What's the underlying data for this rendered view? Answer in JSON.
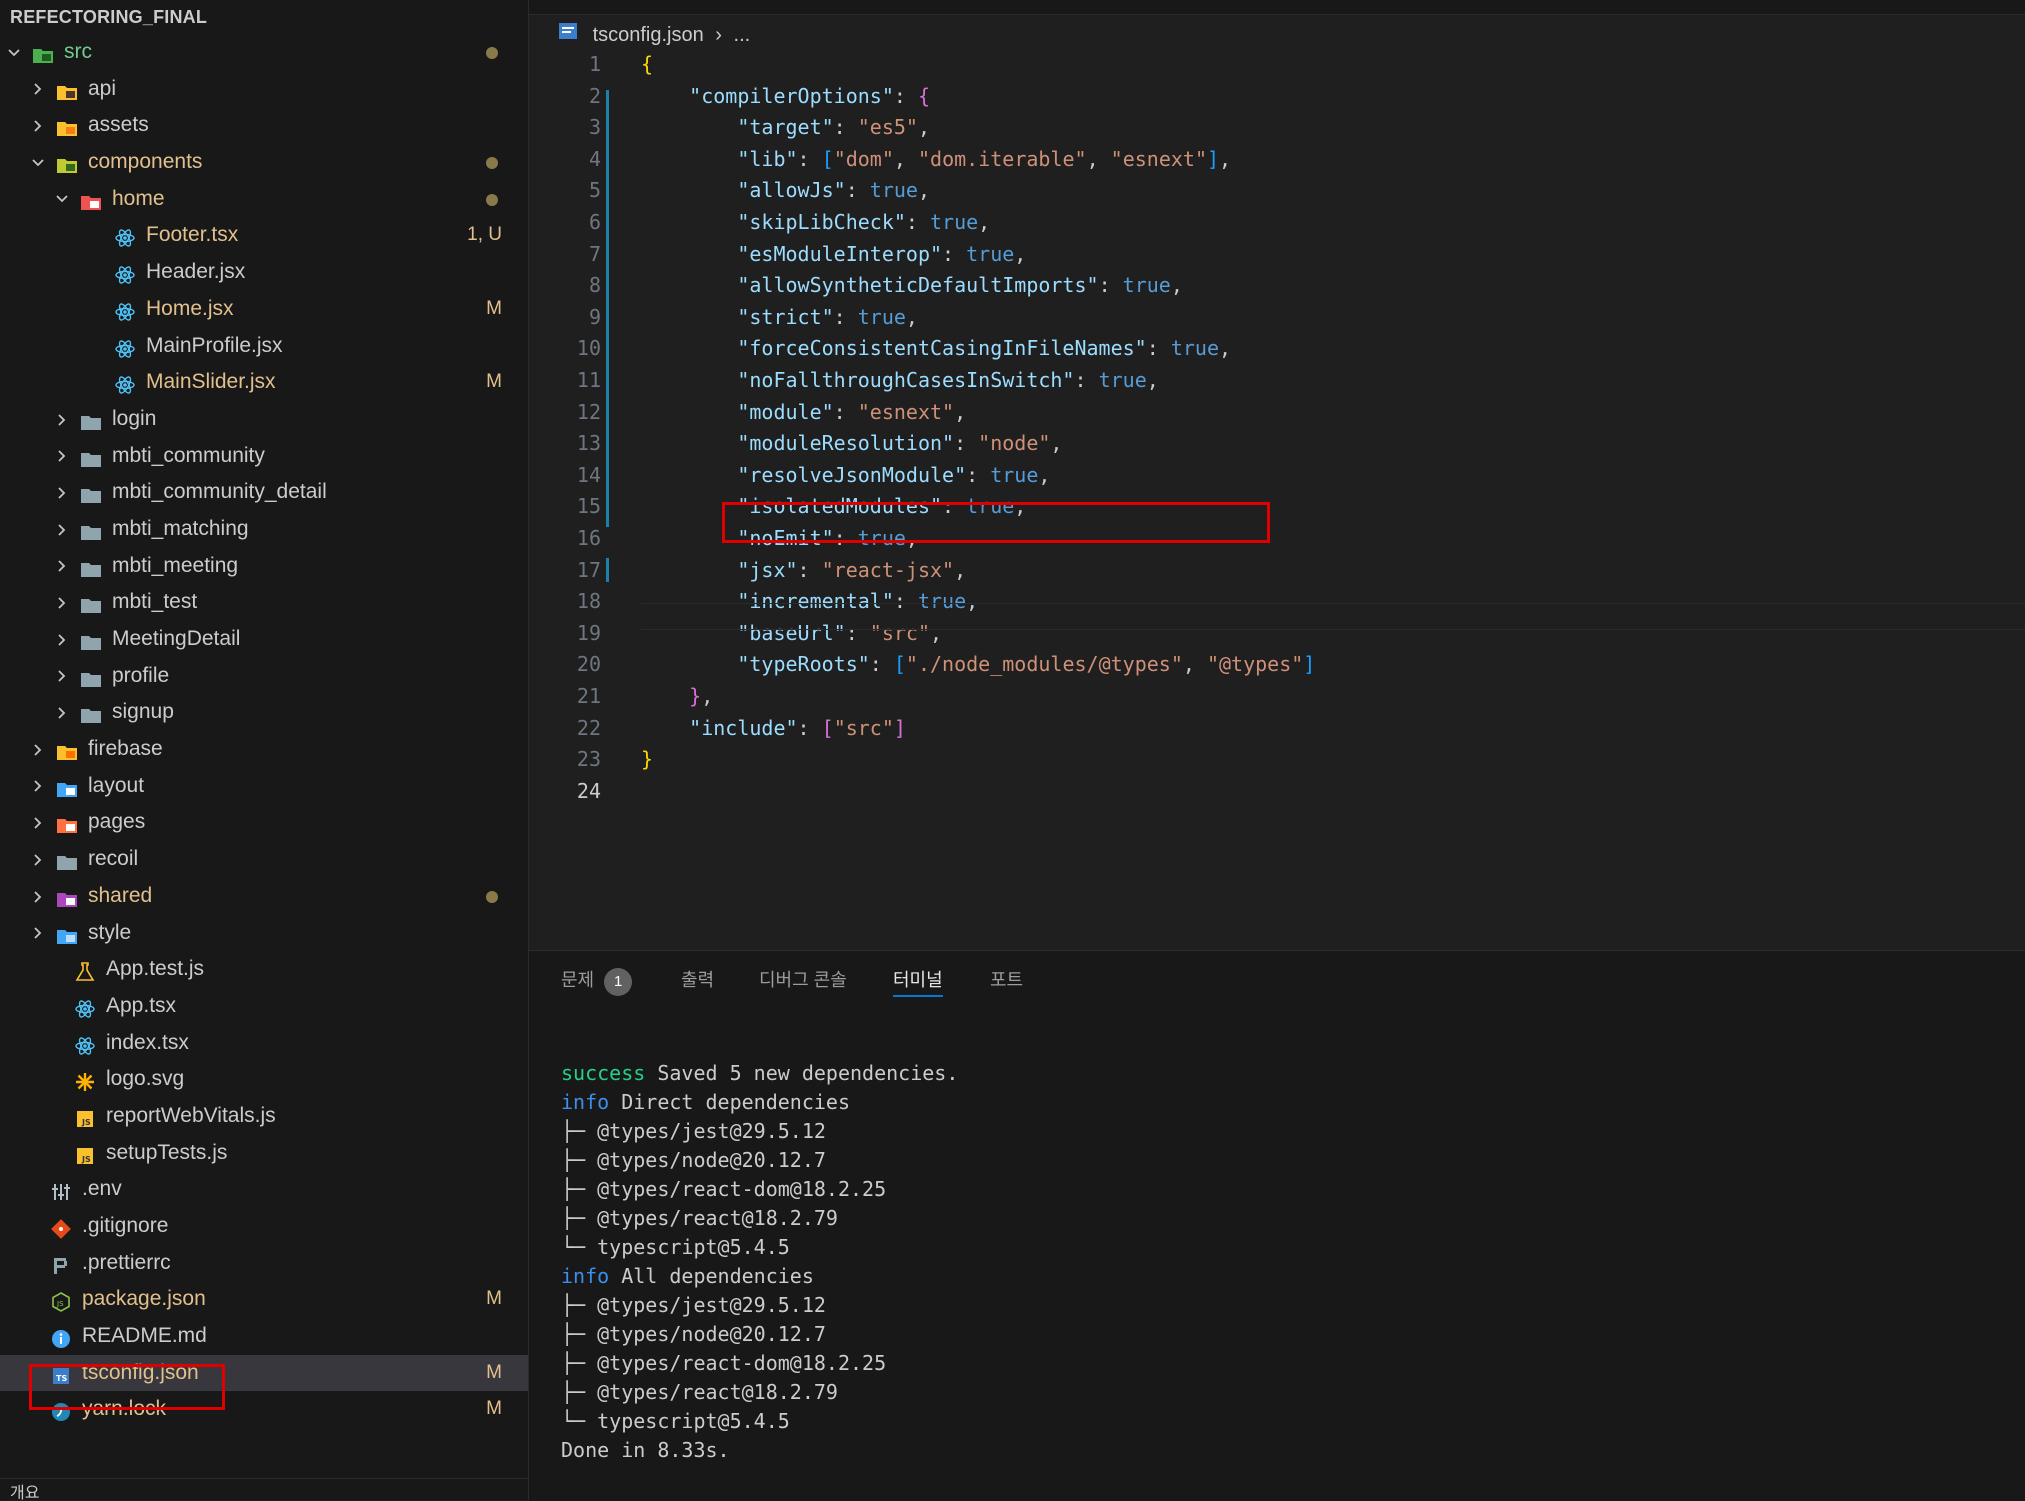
{
  "explorer": {
    "project": "REFECTORING_FINAL",
    "items": [
      {
        "label": "src",
        "type": "folder",
        "expanded": true,
        "depth": 0,
        "color": "untracked",
        "dot": true,
        "icon": "src-folder-icon"
      },
      {
        "label": "api",
        "type": "folder",
        "expanded": false,
        "depth": 1,
        "color": "default",
        "icon": "api-folder-icon"
      },
      {
        "label": "assets",
        "type": "folder",
        "expanded": false,
        "depth": 1,
        "color": "default",
        "icon": "assets-folder-icon"
      },
      {
        "label": "components",
        "type": "folder",
        "expanded": true,
        "depth": 1,
        "color": "modified",
        "dot": true,
        "icon": "components-folder-icon"
      },
      {
        "label": "home",
        "type": "folder",
        "expanded": true,
        "depth": 2,
        "color": "modified",
        "dot": true,
        "icon": "home-folder-icon"
      },
      {
        "label": "Footer.tsx",
        "type": "file",
        "depth": 3,
        "color": "modified",
        "badge": "1, U",
        "icon": "react-icon"
      },
      {
        "label": "Header.jsx",
        "type": "file",
        "depth": 3,
        "color": "default",
        "icon": "react-icon"
      },
      {
        "label": "Home.jsx",
        "type": "file",
        "depth": 3,
        "color": "modified",
        "badge": "M",
        "icon": "react-icon"
      },
      {
        "label": "MainProfile.jsx",
        "type": "file",
        "depth": 3,
        "color": "default",
        "icon": "react-icon"
      },
      {
        "label": "MainSlider.jsx",
        "type": "file",
        "depth": 3,
        "color": "modified",
        "badge": "M",
        "icon": "react-icon"
      },
      {
        "label": "login",
        "type": "folder",
        "expanded": false,
        "depth": 2,
        "color": "default",
        "icon": "folder-icon"
      },
      {
        "label": "mbti_community",
        "type": "folder",
        "expanded": false,
        "depth": 2,
        "color": "default",
        "icon": "folder-icon"
      },
      {
        "label": "mbti_community_detail",
        "type": "folder",
        "expanded": false,
        "depth": 2,
        "color": "default",
        "icon": "folder-icon"
      },
      {
        "label": "mbti_matching",
        "type": "folder",
        "expanded": false,
        "depth": 2,
        "color": "default",
        "icon": "folder-icon"
      },
      {
        "label": "mbti_meeting",
        "type": "folder",
        "expanded": false,
        "depth": 2,
        "color": "default",
        "icon": "folder-icon"
      },
      {
        "label": "mbti_test",
        "type": "folder",
        "expanded": false,
        "depth": 2,
        "color": "default",
        "icon": "folder-icon"
      },
      {
        "label": "MeetingDetail",
        "type": "folder",
        "expanded": false,
        "depth": 2,
        "color": "default",
        "icon": "folder-icon"
      },
      {
        "label": "profile",
        "type": "folder",
        "expanded": false,
        "depth": 2,
        "color": "default",
        "icon": "folder-icon"
      },
      {
        "label": "signup",
        "type": "folder",
        "expanded": false,
        "depth": 2,
        "color": "default",
        "icon": "folder-icon"
      },
      {
        "label": "firebase",
        "type": "folder",
        "expanded": false,
        "depth": 1,
        "color": "default",
        "icon": "firebase-folder-icon"
      },
      {
        "label": "layout",
        "type": "folder",
        "expanded": false,
        "depth": 1,
        "color": "default",
        "icon": "layout-folder-icon"
      },
      {
        "label": "pages",
        "type": "folder",
        "expanded": false,
        "depth": 1,
        "color": "default",
        "icon": "pages-folder-icon"
      },
      {
        "label": "recoil",
        "type": "folder",
        "expanded": false,
        "depth": 1,
        "color": "default",
        "icon": "folder-icon"
      },
      {
        "label": "shared",
        "type": "folder",
        "expanded": false,
        "depth": 1,
        "color": "modified",
        "dot": true,
        "icon": "shared-folder-icon"
      },
      {
        "label": "style",
        "type": "folder",
        "expanded": false,
        "depth": 1,
        "color": "default",
        "icon": "style-folder-icon"
      },
      {
        "label": "App.test.js",
        "type": "file",
        "depth": 1,
        "color": "default",
        "icon": "test-icon"
      },
      {
        "label": "App.tsx",
        "type": "file",
        "depth": 1,
        "color": "default",
        "icon": "react-icon"
      },
      {
        "label": "index.tsx",
        "type": "file",
        "depth": 1,
        "color": "default",
        "icon": "react-icon"
      },
      {
        "label": "logo.svg",
        "type": "file",
        "depth": 1,
        "color": "default",
        "icon": "svg-icon"
      },
      {
        "label": "reportWebVitals.js",
        "type": "file",
        "depth": 1,
        "color": "default",
        "icon": "js-icon"
      },
      {
        "label": "setupTests.js",
        "type": "file",
        "depth": 1,
        "color": "default",
        "icon": "js-icon"
      },
      {
        "label": ".env",
        "type": "file",
        "depth": 0,
        "color": "default",
        "icon": "env-icon"
      },
      {
        "label": ".gitignore",
        "type": "file",
        "depth": 0,
        "color": "default",
        "icon": "git-icon"
      },
      {
        "label": ".prettierrc",
        "type": "file",
        "depth": 0,
        "color": "default",
        "icon": "prettier-icon"
      },
      {
        "label": "package.json",
        "type": "file",
        "depth": 0,
        "color": "modified",
        "badge": "M",
        "icon": "npm-icon"
      },
      {
        "label": "README.md",
        "type": "file",
        "depth": 0,
        "color": "default",
        "icon": "info-icon"
      },
      {
        "label": "tsconfig.json",
        "type": "file",
        "depth": 0,
        "color": "modified",
        "badge": "M",
        "selected": true,
        "highlighted": true,
        "icon": "tsconfig-icon"
      },
      {
        "label": "yarn.lock",
        "type": "file",
        "depth": 0,
        "color": "modified",
        "badge": "M",
        "icon": "yarn-icon"
      }
    ],
    "bottom_label": "개요"
  },
  "editor": {
    "breadcrumb": {
      "file": "tsconfig.json",
      "sep": "›",
      "rest": "..."
    },
    "current_line": 24,
    "highlight_line": 20,
    "lines": [
      [
        [
          "{",
          "br1"
        ]
      ],
      [
        [
          "    ",
          ""
        ],
        [
          "\"compilerOptions\"",
          "k"
        ],
        [
          ": ",
          ""
        ],
        [
          "{",
          "br2"
        ]
      ],
      [
        [
          "        ",
          ""
        ],
        [
          "\"target\"",
          "k"
        ],
        [
          ": ",
          ""
        ],
        [
          "\"es5\"",
          "s"
        ],
        [
          ",",
          ""
        ]
      ],
      [
        [
          "        ",
          ""
        ],
        [
          "\"lib\"",
          "k"
        ],
        [
          ": ",
          ""
        ],
        [
          "[",
          "br3"
        ],
        [
          "\"dom\"",
          "s"
        ],
        [
          ", ",
          ""
        ],
        [
          "\"dom.iterable\"",
          "s"
        ],
        [
          ", ",
          ""
        ],
        [
          "\"esnext\"",
          "s"
        ],
        [
          "]",
          "br3"
        ],
        [
          ",",
          ""
        ]
      ],
      [
        [
          "        ",
          ""
        ],
        [
          "\"allowJs\"",
          "k"
        ],
        [
          ": ",
          ""
        ],
        [
          "true",
          "b"
        ],
        [
          ",",
          ""
        ]
      ],
      [
        [
          "        ",
          ""
        ],
        [
          "\"skipLibCheck\"",
          "k"
        ],
        [
          ": ",
          ""
        ],
        [
          "true",
          "b"
        ],
        [
          ",",
          ""
        ]
      ],
      [
        [
          "        ",
          ""
        ],
        [
          "\"esModuleInterop\"",
          "k"
        ],
        [
          ": ",
          ""
        ],
        [
          "true",
          "b"
        ],
        [
          ",",
          ""
        ]
      ],
      [
        [
          "        ",
          ""
        ],
        [
          "\"allowSyntheticDefaultImports\"",
          "k"
        ],
        [
          ": ",
          ""
        ],
        [
          "true",
          "b"
        ],
        [
          ",",
          ""
        ]
      ],
      [
        [
          "        ",
          ""
        ],
        [
          "\"strict\"",
          "k"
        ],
        [
          ": ",
          ""
        ],
        [
          "true",
          "b"
        ],
        [
          ",",
          ""
        ]
      ],
      [
        [
          "        ",
          ""
        ],
        [
          "\"forceConsistentCasingInFileNames\"",
          "k"
        ],
        [
          ": ",
          ""
        ],
        [
          "true",
          "b"
        ],
        [
          ",",
          ""
        ]
      ],
      [
        [
          "        ",
          ""
        ],
        [
          "\"noFallthroughCasesInSwitch\"",
          "k"
        ],
        [
          ": ",
          ""
        ],
        [
          "true",
          "b"
        ],
        [
          ",",
          ""
        ]
      ],
      [
        [
          "        ",
          ""
        ],
        [
          "\"module\"",
          "k"
        ],
        [
          ": ",
          ""
        ],
        [
          "\"esnext\"",
          "s"
        ],
        [
          ",",
          ""
        ]
      ],
      [
        [
          "        ",
          ""
        ],
        [
          "\"moduleResolution\"",
          "k"
        ],
        [
          ": ",
          ""
        ],
        [
          "\"node\"",
          "s"
        ],
        [
          ",",
          ""
        ]
      ],
      [
        [
          "        ",
          ""
        ],
        [
          "\"resolveJsonModule\"",
          "k"
        ],
        [
          ": ",
          ""
        ],
        [
          "true",
          "b"
        ],
        [
          ",",
          ""
        ]
      ],
      [
        [
          "        ",
          ""
        ],
        [
          "\"isolatedModules\"",
          "k"
        ],
        [
          ": ",
          ""
        ],
        [
          "true",
          "b"
        ],
        [
          ",",
          ""
        ]
      ],
      [
        [
          "        ",
          ""
        ],
        [
          "\"noEmit\"",
          "k"
        ],
        [
          ": ",
          ""
        ],
        [
          "true",
          "b"
        ],
        [
          ",",
          ""
        ]
      ],
      [
        [
          "        ",
          ""
        ],
        [
          "\"jsx\"",
          "k"
        ],
        [
          ": ",
          ""
        ],
        [
          "\"react-jsx\"",
          "s"
        ],
        [
          ",",
          ""
        ]
      ],
      [
        [
          "        ",
          ""
        ],
        [
          "\"incremental\"",
          "k"
        ],
        [
          ": ",
          ""
        ],
        [
          "true",
          "b"
        ],
        [
          ",",
          ""
        ]
      ],
      [
        [
          "        ",
          ""
        ],
        [
          "\"baseUrl\"",
          "k"
        ],
        [
          ": ",
          ""
        ],
        [
          "\"src\"",
          "s"
        ],
        [
          ",",
          ""
        ]
      ],
      [
        [
          "        ",
          ""
        ],
        [
          "\"typeRoots\"",
          "k"
        ],
        [
          ": ",
          ""
        ],
        [
          "[",
          "br3"
        ],
        [
          "\"./node_modules/@types\"",
          "s"
        ],
        [
          ", ",
          ""
        ],
        [
          "\"@types\"",
          "s"
        ],
        [
          "]",
          "br3"
        ]
      ],
      [
        [
          "    ",
          ""
        ],
        [
          "}",
          "br2"
        ],
        [
          ",",
          ""
        ]
      ],
      [
        [
          "    ",
          ""
        ],
        [
          "\"include\"",
          "k"
        ],
        [
          ": ",
          ""
        ],
        [
          "[",
          "br2"
        ],
        [
          "\"src\"",
          "s"
        ],
        [
          "]",
          "br2"
        ]
      ],
      [
        [
          "}",
          "br1"
        ]
      ],
      []
    ]
  },
  "panel": {
    "tabs": [
      {
        "label": "문제",
        "badge": "1"
      },
      {
        "label": "출력"
      },
      {
        "label": "디버그 콘솔"
      },
      {
        "label": "터미널",
        "active": true
      },
      {
        "label": "포트"
      }
    ],
    "terminal": [
      [
        [
          "success",
          "t-success"
        ],
        [
          " Saved 5 new dependencies.",
          ""
        ]
      ],
      [
        [
          "info",
          "t-info"
        ],
        [
          " Direct dependencies",
          ""
        ]
      ],
      [
        [
          "├─ @types/jest@29.5.12",
          ""
        ]
      ],
      [
        [
          "├─ @types/node@20.12.7",
          ""
        ]
      ],
      [
        [
          "├─ @types/react-dom@18.2.25",
          ""
        ]
      ],
      [
        [
          "├─ @types/react@18.2.79",
          ""
        ]
      ],
      [
        [
          "└─ typescript@5.4.5",
          ""
        ]
      ],
      [
        [
          "info",
          "t-info"
        ],
        [
          " All dependencies",
          ""
        ]
      ],
      [
        [
          "├─ @types/jest@29.5.12",
          ""
        ]
      ],
      [
        [
          "├─ @types/node@20.12.7",
          ""
        ]
      ],
      [
        [
          "├─ @types/react-dom@18.2.25",
          ""
        ]
      ],
      [
        [
          "├─ @types/react@18.2.79",
          ""
        ]
      ],
      [
        [
          "└─ typescript@5.4.5",
          ""
        ]
      ],
      [
        [
          "Done in 8.33s.",
          ""
        ]
      ]
    ]
  },
  "colors": {
    "modified": "#e2c08d",
    "untracked": "#73c991",
    "highlight_box": "#e00000",
    "accent": "#0078d4"
  }
}
